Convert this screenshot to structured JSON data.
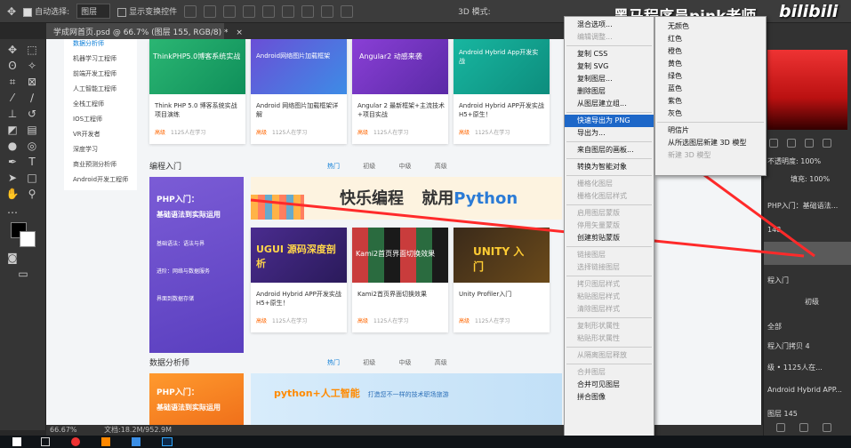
{
  "options_bar": {
    "auto_select_label": "自动选择:",
    "auto_select_value": "图层",
    "show_transform_label": "显示变换控件",
    "mode_3d_label": "3D 模式:"
  },
  "watermark": {
    "author": "黑马程序员pink老师",
    "logo": "bilibili"
  },
  "document_tab": {
    "label": "学成网首页.psd @ 66.7% (图层 155, RGB/8) *"
  },
  "status_bar": {
    "zoom": "66.67%",
    "doc_size": "文档:18.2M/952.9M"
  },
  "webpage": {
    "sidebar_items": [
      "数据分析师",
      "机器学习工程师",
      "前端开发工程师",
      "人工智能工程师",
      "全栈工程师",
      "IOS工程师",
      "VR开发者",
      "深度学习",
      "商业预测分析师",
      "Android开发工程师"
    ],
    "row1_cards": [
      {
        "thumb": "ThinkPHP5.0博客系统实战",
        "title": "Think PHP 5.0 博客系统实战项目演练",
        "level": "高级",
        "learners": "1125人在学习"
      },
      {
        "thumb": "Android网络图片加载框架",
        "title": "Android 网络图片加载框架详解",
        "level": "高级",
        "learners": "1125人在学习"
      },
      {
        "thumb": "Angular2 动感来袭",
        "title": "Angular 2 最新框架+主流技术+项目实战",
        "level": "高级",
        "learners": "1125人在学习"
      },
      {
        "thumb": "Android Hybrid App开发实战",
        "title": "Android Hybrid APP开发实战 H5+原生！",
        "level": "高级",
        "learners": "1125人在学习"
      }
    ],
    "section1": {
      "title": "编程入门",
      "tabs": [
        "热门",
        "初级",
        "中级",
        "高级"
      ]
    },
    "promo_tile": {
      "line1": "PHP入门：",
      "line2": "基础语法到实际运用",
      "p1": "基础语法：语法与界",
      "p2": "进阶：网络与数据服务",
      "p3": "界面到数据存储"
    },
    "banner_python": {
      "text1": "快乐编程",
      "text2": "就用",
      "text3": "Python"
    },
    "row2_cards": [
      {
        "thumb": "UGUI 源码深度剖析",
        "title": "Android Hybrid APP开发实战 H5+原生！",
        "level": "高级",
        "learners": "1125人在学习"
      },
      {
        "thumb": "Kami2首页界面切换效果",
        "title": "Kami2首页界面切换效果",
        "level": "高级",
        "learners": "1125人在学习"
      },
      {
        "thumb": "UNITY 入门",
        "title": "Unity Profiler入门",
        "level": "高级",
        "learners": "1125人在学习"
      }
    ],
    "section2": {
      "title": "数据分析师",
      "tabs": [
        "热门",
        "初级",
        "中级",
        "高级"
      ]
    },
    "banner_ai": {
      "text1": "python+人工智能",
      "text2": "打造您不一样的技术职场旅游"
    }
  },
  "context_menu": {
    "items": [
      {
        "label": "混合选项...",
        "disabled": false
      },
      {
        "label": "编辑调整...",
        "disabled": true
      },
      {
        "sep": true
      },
      {
        "label": "复制 CSS",
        "disabled": false
      },
      {
        "label": "复制 SVG",
        "disabled": false
      },
      {
        "label": "复制图层...",
        "disabled": false
      },
      {
        "label": "删除图层",
        "disabled": false
      },
      {
        "label": "从图层建立组...",
        "disabled": false
      },
      {
        "sep": true
      },
      {
        "label": "快速导出为 PNG",
        "disabled": false,
        "highlight": true
      },
      {
        "label": "导出为...",
        "disabled": false
      },
      {
        "sep": true
      },
      {
        "label": "来自图层的画板...",
        "disabled": false
      },
      {
        "sep": true
      },
      {
        "label": "转换为智能对象",
        "disabled": false
      },
      {
        "sep": true
      },
      {
        "label": "栅格化图层",
        "disabled": true
      },
      {
        "label": "栅格化图层样式",
        "disabled": true
      },
      {
        "sep": true
      },
      {
        "label": "启用图层蒙版",
        "disabled": true
      },
      {
        "label": "停用矢量蒙版",
        "disabled": true
      },
      {
        "label": "创建剪贴蒙版",
        "disabled": false
      },
      {
        "sep": true
      },
      {
        "label": "链接图层",
        "disabled": true
      },
      {
        "label": "选择链接图层",
        "disabled": true
      },
      {
        "sep": true
      },
      {
        "label": "拷贝图层样式",
        "disabled": true
      },
      {
        "label": "粘贴图层样式",
        "disabled": true
      },
      {
        "label": "清除图层样式",
        "disabled": true
      },
      {
        "sep": true
      },
      {
        "label": "复制形状属性",
        "disabled": true
      },
      {
        "label": "粘贴形状属性",
        "disabled": true
      },
      {
        "sep": true
      },
      {
        "label": "从隔离图层释放",
        "disabled": true
      },
      {
        "sep": true
      },
      {
        "label": "合并图层",
        "disabled": true
      },
      {
        "label": "合并可见图层",
        "disabled": false
      },
      {
        "label": "拼合图像",
        "disabled": false
      }
    ]
  },
  "color_submenu": {
    "items": [
      "无颜色",
      "红色",
      "橙色",
      "黄色",
      "绿色",
      "蓝色",
      "紫色",
      "灰色",
      "",
      "明信片",
      "从所选图层新建 3D 模型",
      "新建 3D 模型"
    ]
  },
  "right_panel": {
    "opacity_label": "不透明度:",
    "opacity_value": "100%",
    "fill_label": "填充:",
    "fill_value": "100%",
    "layer1": "PHP入门：基础语法...",
    "num148": "148",
    "layer2": "程入门",
    "layer3": "初级",
    "layer4": "全部",
    "layer5": "程入门拷贝 4",
    "layer6": "级 • 1125人在...",
    "layer7": "Android Hybrid APP...",
    "layer8": "图层 145"
  },
  "colors": {
    "highlight": "#1d67c8",
    "arrow": "#ff2a2a"
  }
}
